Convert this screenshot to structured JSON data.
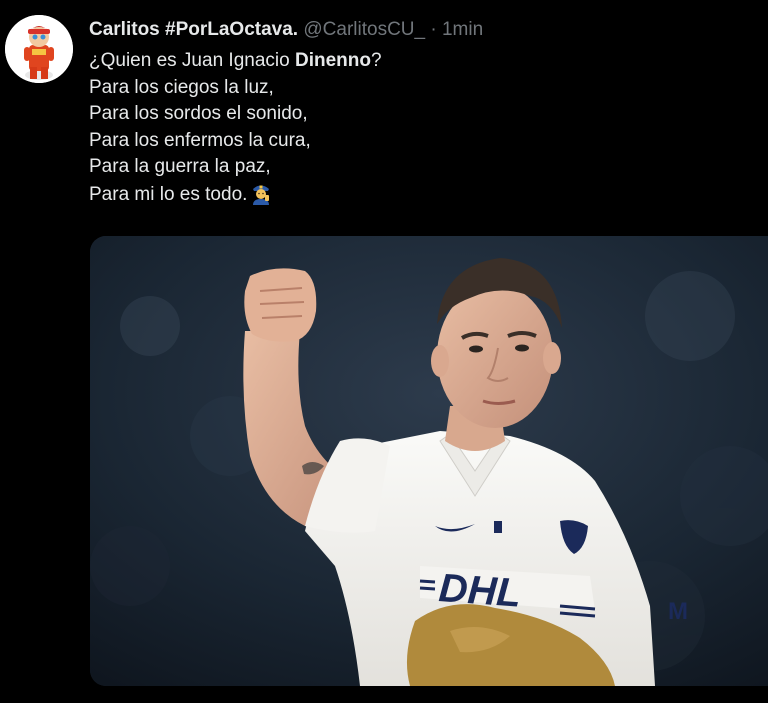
{
  "tweet": {
    "display_name": "Carlitos #PorLaOctava.",
    "handle": "@CarlitosCU_",
    "separator": "·",
    "timestamp": "1min",
    "text_line_1_prefix": "¿Quien es Juan Ignacio ",
    "text_line_1_bold": "Dinenno",
    "text_line_1_suffix": "?",
    "text_line_2": "Para los ciegos la luz,",
    "text_line_3": "Para los sordos el sonido,",
    "text_line_4": "Para los enfermos la cura,",
    "text_line_5": "Para la guerra la paz,",
    "text_line_6": "Para mi lo es todo.",
    "emoji": "police-officer-emoji"
  },
  "media": {
    "jersey_sponsor": "DHL",
    "jersey_sleeve_text": "M"
  },
  "colors": {
    "background": "#000000",
    "primary_text": "#e7e9ea",
    "secondary_text": "#71767b",
    "jersey": "#f2f0ec",
    "jersey_gold": "#b08a3c",
    "sponsor_navy": "#1b2a5a"
  }
}
